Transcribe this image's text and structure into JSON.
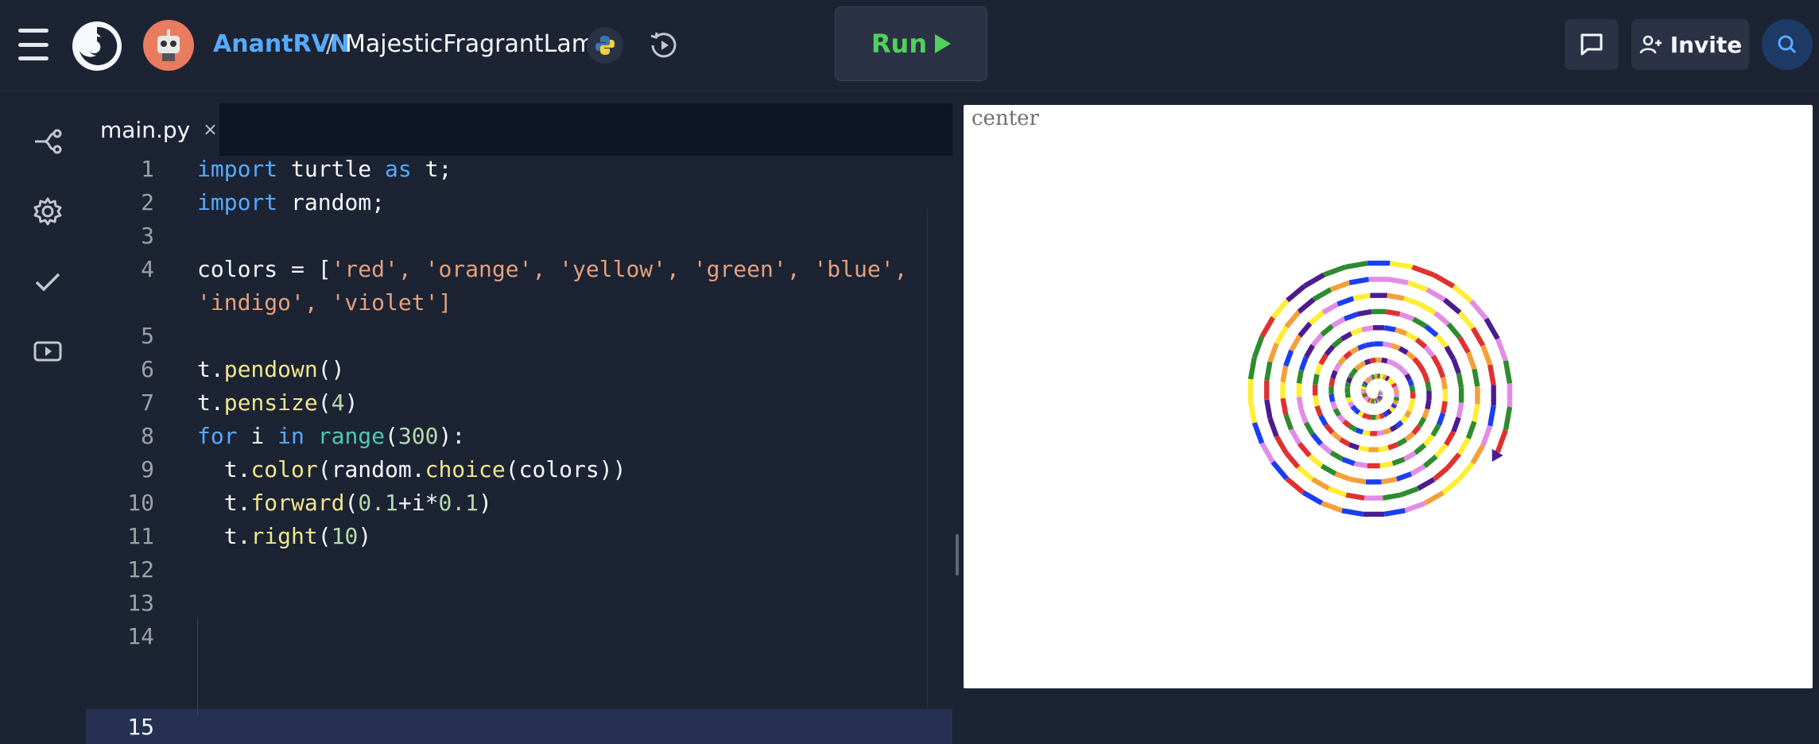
{
  "header": {
    "user": "AnantRVN",
    "separator": "/",
    "repl_name": "MajesticFragrantLamp",
    "run_label": "Run",
    "invite_label": "Invite"
  },
  "editor": {
    "tab_label": "main.py",
    "tab_close": "×",
    "line_numbers": [
      "1",
      "2",
      "3",
      "4",
      "",
      "5",
      "6",
      "7",
      "8",
      "9",
      "10",
      "11",
      "12",
      "13",
      "14",
      "15"
    ]
  },
  "output": {
    "label": "center",
    "spiral_colors": [
      "red",
      "orange",
      "yellow",
      "green",
      "blue",
      "indigo",
      "violet"
    ],
    "pen_size": 4,
    "iterations": 300,
    "step_base": 0.1,
    "step_increment": 0.1,
    "turn_degrees": 10
  },
  "icons": {
    "menu": "hamburger-icon",
    "logo": "replit-logo",
    "python": "python-icon",
    "history": "history-icon",
    "chat": "chat-icon",
    "invite": "add-user-icon",
    "search": "search-icon",
    "files": "git-branch-icon",
    "settings": "gear-icon",
    "check": "check-icon",
    "video": "video-icon"
  },
  "colors": {
    "bg": "#1c2333",
    "accent_blue": "#57abff",
    "run_green": "#4fd15c"
  }
}
